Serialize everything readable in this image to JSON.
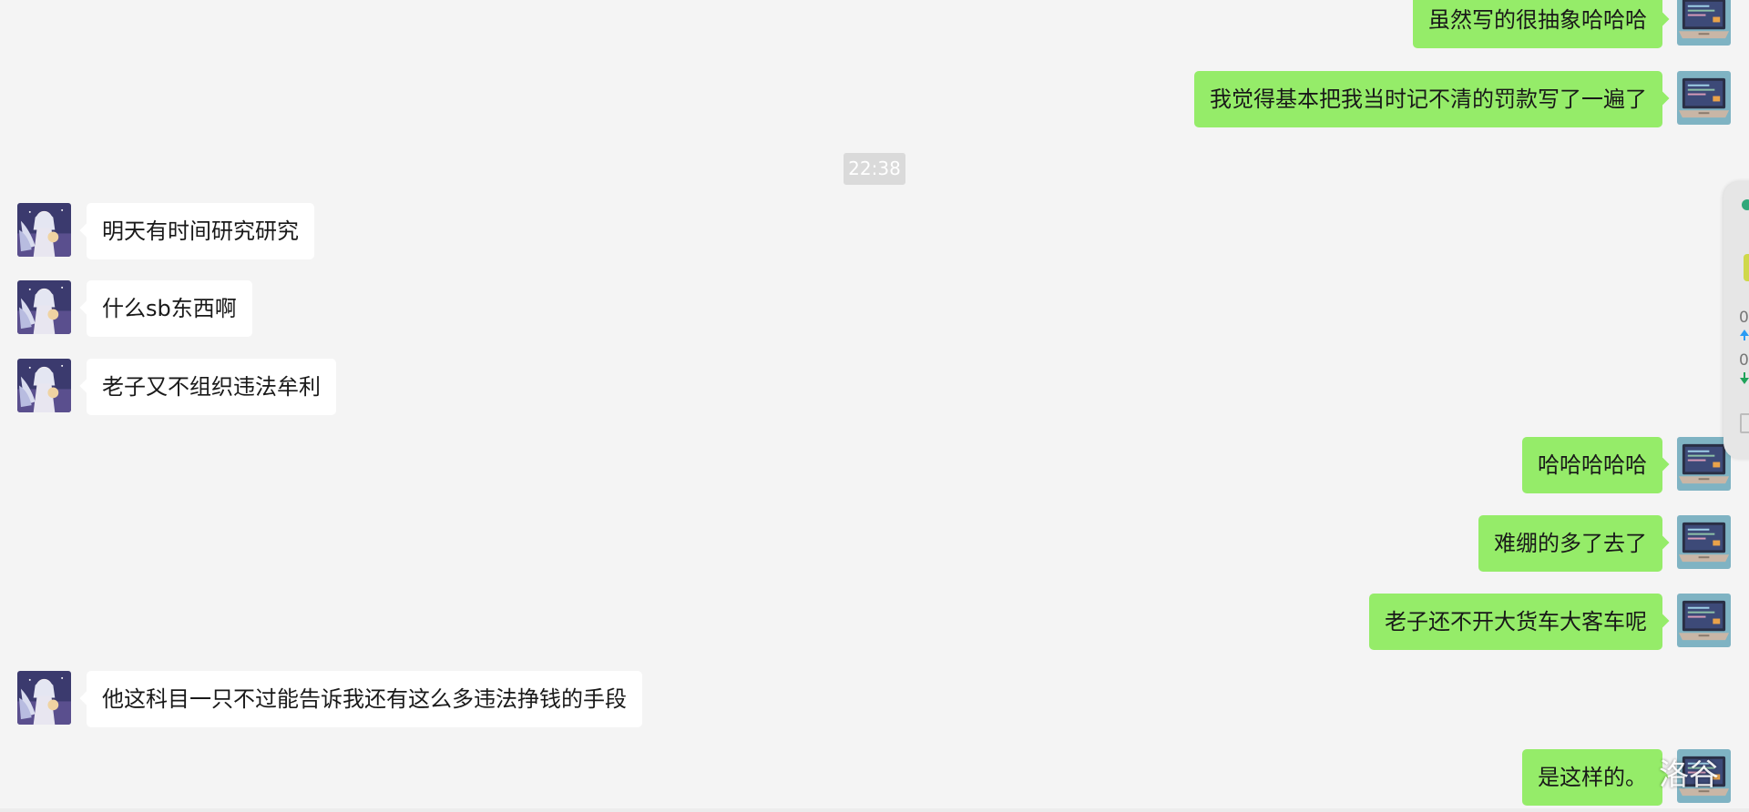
{
  "timestamp": "22:38",
  "messages": [
    {
      "side": "right",
      "avatar": "laptop-avatar",
      "text": "虽然写的很抽象哈哈哈"
    },
    {
      "side": "right",
      "avatar": "laptop-avatar",
      "text": "我觉得基本把我当时记不清的罚款写了一遍了"
    },
    {
      "side": "left",
      "avatar": "anime-angel-avatar",
      "text": "明天有时间研究研究"
    },
    {
      "side": "left",
      "avatar": "anime-angel-avatar",
      "text": "什么sb东西啊"
    },
    {
      "side": "left",
      "avatar": "anime-angel-avatar",
      "text": "老子又不组织违法牟利"
    },
    {
      "side": "right",
      "avatar": "laptop-avatar",
      "text": "哈哈哈哈哈"
    },
    {
      "side": "right",
      "avatar": "laptop-avatar",
      "text": "难绷的多了去了"
    },
    {
      "side": "right",
      "avatar": "laptop-avatar",
      "text": "老子还不开大货车大客车呢"
    },
    {
      "side": "left",
      "avatar": "anime-angel-avatar",
      "text": "他这科目一只不过能告诉我还有这么多违法挣钱的手段"
    },
    {
      "side": "right",
      "avatar": "laptop-avatar",
      "text": "是这样的。"
    }
  ],
  "side_panel": {
    "values": [
      "0",
      "0"
    ],
    "icons": [
      "status-dot-icon",
      "upload-arrow-icon",
      "download-arrow-icon",
      "copy-icon"
    ]
  },
  "watermark": "洛谷",
  "colors": {
    "background": "#f4f4f4",
    "bubble_self": "#95ec69",
    "bubble_other": "#ffffff",
    "timestamp_bg": "#dadada"
  }
}
